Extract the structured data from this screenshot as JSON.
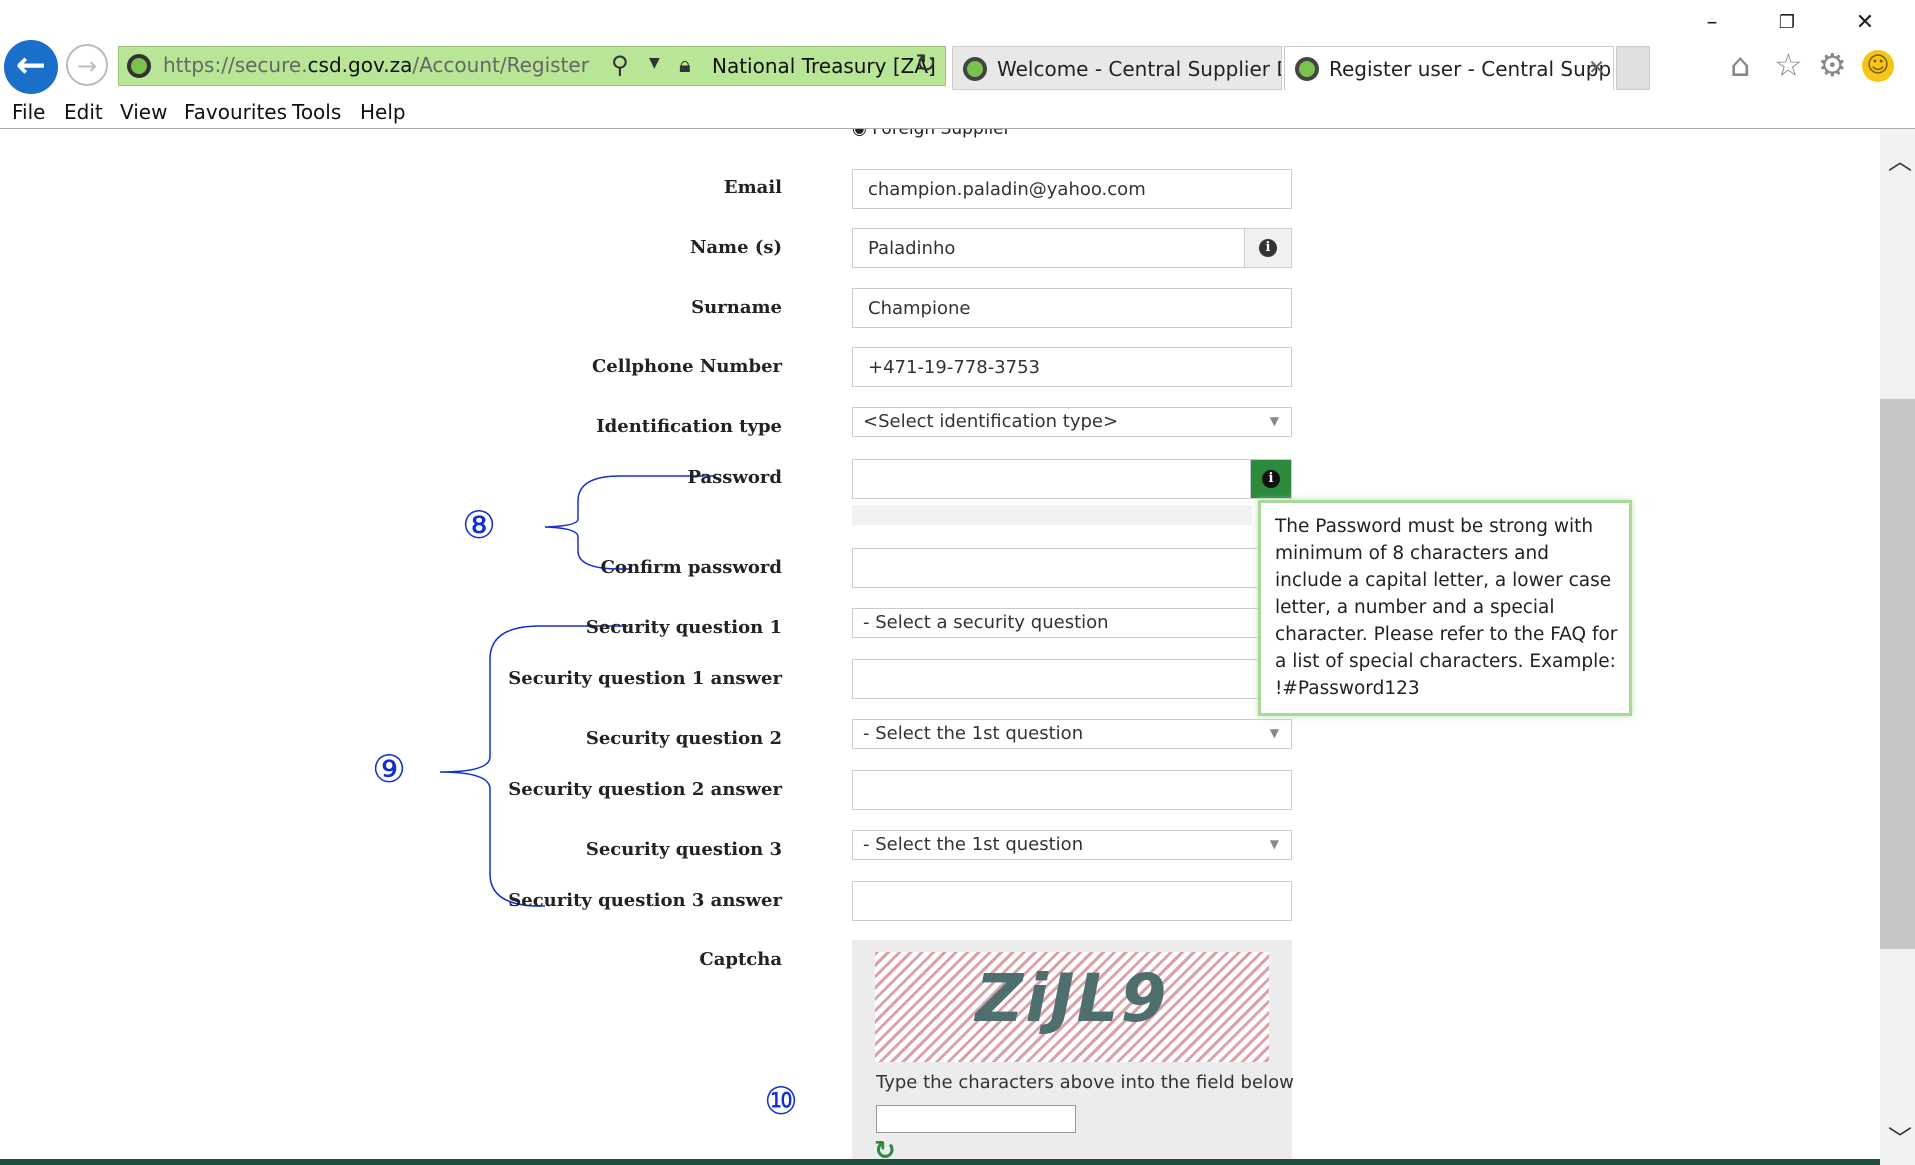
{
  "browser": {
    "address": {
      "url_scheme": "https://",
      "url_sub": "secure.",
      "url_host": "csd.gov.za",
      "url_path": "/Account/Register",
      "cert_label": "National Treasury [ZA]"
    },
    "tabs": [
      {
        "label": "Welcome - Central Supplier Da..."
      },
      {
        "label": "Register user - Central Supp..."
      }
    ],
    "window_buttons": {
      "minimize": "–",
      "restore": "❐",
      "close": "✕"
    },
    "menu": [
      "File",
      "Edit",
      "View",
      "Favourites",
      "Tools",
      "Help"
    ]
  },
  "form": {
    "top_radio_label": "Foreign Supplier",
    "email": {
      "label": "Email",
      "value": "champion.paladin@yahoo.com"
    },
    "names": {
      "label": "Name (s)",
      "value": "Paladinho"
    },
    "surname": {
      "label": "Surname",
      "value": "Champione"
    },
    "cellphone": {
      "label": "Cellphone Number",
      "value": "+471-19-778-3753"
    },
    "id_type": {
      "label": "Identification type",
      "value": "<Select identification type>"
    },
    "password": {
      "label": "Password",
      "value": ""
    },
    "confirm_password": {
      "label": "Confirm password",
      "value": ""
    },
    "sq1": {
      "label": "Security question 1",
      "value": "- Select a security question"
    },
    "sq1_answer": {
      "label": "Security question 1 answer",
      "value": ""
    },
    "sq2": {
      "label": "Security question 2",
      "value": "- Select the 1st question"
    },
    "sq2_answer": {
      "label": "Security question 2 answer",
      "value": ""
    },
    "sq3": {
      "label": "Security question 3",
      "value": "- Select the 1st question"
    },
    "sq3_answer": {
      "label": "Security question 3 answer",
      "value": ""
    },
    "captcha": {
      "label": "Captcha",
      "code": "ZiJL9",
      "hint": "Type the characters above into the field below"
    }
  },
  "tooltip": {
    "text": "The Password must be strong with minimum of 8 characters and include a capital letter, a lower case letter, a number and a special character. Please refer to the FAQ for a list of special characters. Example: !#Password123"
  },
  "annotations": {
    "a8": "⑧",
    "a9": "⑨",
    "a10": "⑩"
  },
  "colors": {
    "accent_green": "#2b8a3e",
    "annotation_blue": "#1030d0",
    "address_bar": "#b9e596"
  }
}
